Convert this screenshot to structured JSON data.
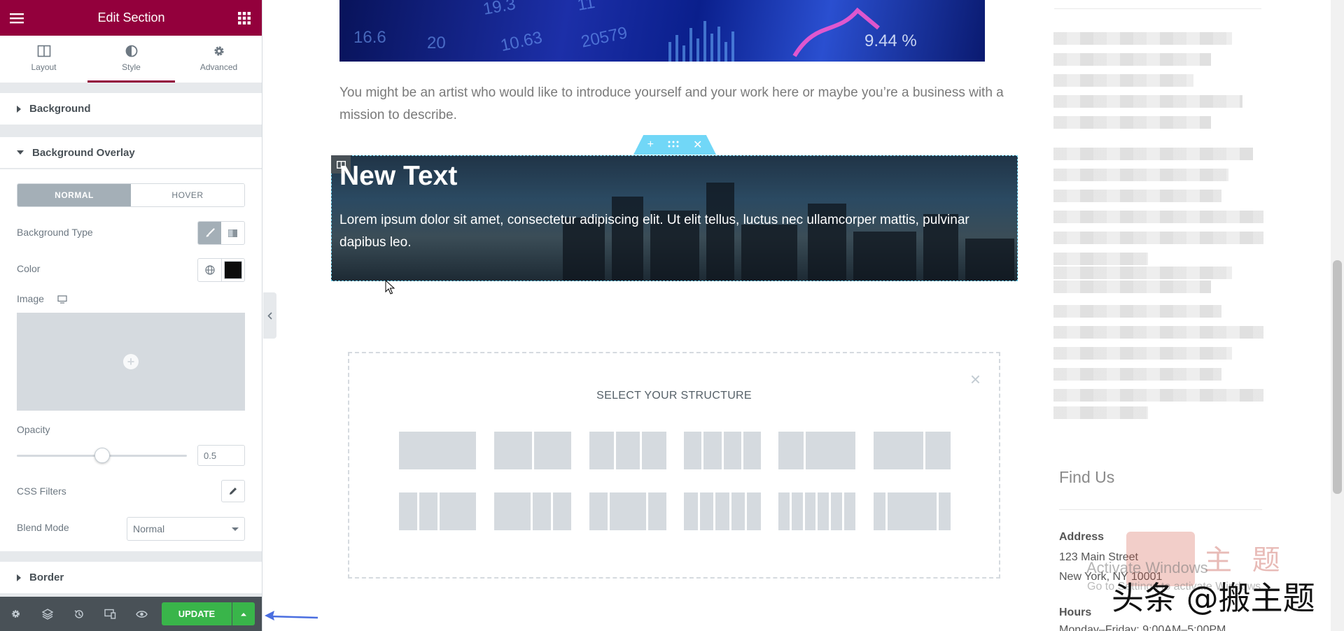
{
  "panel": {
    "title": "Edit Section",
    "tabs": [
      {
        "label": "Layout",
        "icon": "layout-columns-icon"
      },
      {
        "label": "Style",
        "icon": "half-circle-icon"
      },
      {
        "label": "Advanced",
        "icon": "gear-icon"
      }
    ],
    "active_tab": "Style",
    "accent_color": "#93003c",
    "sections": {
      "background": "Background",
      "background_overlay": "Background Overlay",
      "border": "Border"
    },
    "overlay": {
      "state_normal": "NORMAL",
      "state_hover": "HOVER",
      "background_type_label": "Background Type",
      "color_label": "Color",
      "color_value": "#0c0c0c",
      "image_label": "Image",
      "opacity_label": "Opacity",
      "opacity_value": "0.5",
      "css_filters_label": "CSS Filters",
      "blend_mode_label": "Blend Mode",
      "blend_mode_value": "Normal"
    },
    "footer": {
      "update_label": "UPDATE",
      "update_color": "#39b54a"
    }
  },
  "preview": {
    "hero_numbers": [
      "16.6",
      "20",
      "10.63",
      "20579",
      "19.3",
      "11",
      "9.44 %"
    ],
    "intro_text": "You might be an artist who would like to introduce yourself and your work here or maybe you’re a business with a mission to describe.",
    "section_heading": "New Text",
    "section_body": "Lorem ipsum dolor sit amet, consectetur adipiscing elit. Ut elit tellus, luctus nec ullamcorper mattis, pulvinar dapibus leo.",
    "structure_title": "SELECT YOUR STRUCTURE",
    "structure_close": "×",
    "handle_add": "+",
    "handle_close": "✕"
  },
  "sidebar": {
    "find_us": "Find Us",
    "address_heading": "Address",
    "address_line1": "123 Main Street",
    "address_line2": "New York, NY 10001",
    "hours_heading": "Hours",
    "hours_line": "Monday–Friday: 9:00AM–5:00PM"
  },
  "overlays": {
    "activate_title": "Activate Windows",
    "activate_sub": "Go to Settings to activate Windows.",
    "watermark_main": "头条 @搬主题",
    "watermark_faded": "主 题"
  }
}
